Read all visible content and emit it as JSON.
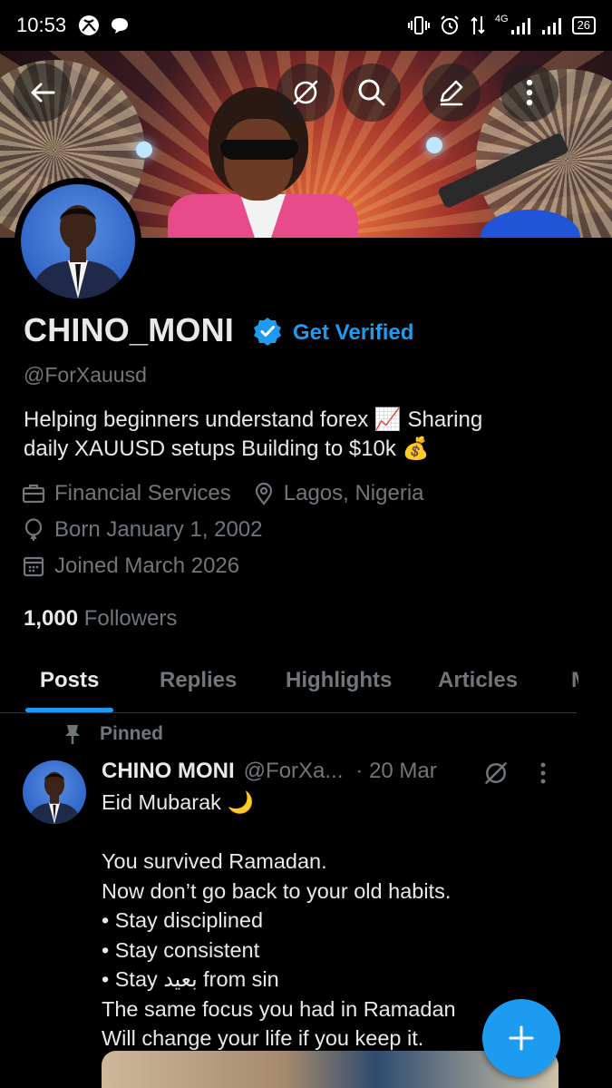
{
  "status_bar": {
    "time": "10:53",
    "battery": "26",
    "network": "4G"
  },
  "profile": {
    "name": "CHINO_MONI",
    "get_verified": "Get Verified",
    "handle": "@ForXauusd",
    "bio_line1": "Helping beginners understand forex 📈 Sharing",
    "bio_line2": "daily XAUUSD setups Building to $10k 💰",
    "category": "Financial Services",
    "location": "Lagos, Nigeria",
    "born": "Born January 1, 2002",
    "joined": "Joined March 2026",
    "followers_count": "1,000",
    "followers_label": "Followers"
  },
  "tabs": [
    {
      "label": "Posts",
      "active": true
    },
    {
      "label": "Replies",
      "active": false
    },
    {
      "label": "Highlights",
      "active": false
    },
    {
      "label": "Articles",
      "active": false
    },
    {
      "label": "M",
      "active": false
    }
  ],
  "pinned_post": {
    "pinned_label": "Pinned",
    "author": "CHINO MONI",
    "handle": "@ForXa...",
    "date": "· 20 Mar",
    "text": "Eid Mubarak 🌙\n\nYou survived Ramadan.\nNow don’t go back to your old habits.\n• Stay disciplined\n• Stay consistent\n• Stay بعيد from sin\nThe same focus you had in Ramadan\nWill change your life if you keep it."
  },
  "colors": {
    "accent": "#1d9bf0",
    "muted": "#71767b",
    "text": "#e7e9ea",
    "background": "#000000"
  },
  "icons": {
    "back": "back-arrow-icon",
    "grok": "grok-icon",
    "search": "search-icon",
    "edit": "edit-icon",
    "more": "more-vertical-icon",
    "fab": "plus-icon"
  }
}
